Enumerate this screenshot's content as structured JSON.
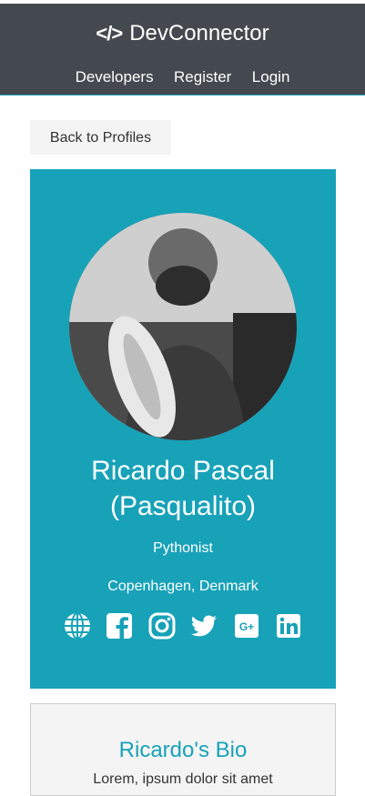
{
  "navbar": {
    "brand_code_icon": "code-icon",
    "brand": "DevConnector",
    "links": [
      "Developers",
      "Register",
      "Login"
    ]
  },
  "back_button": "Back to Profiles",
  "profile": {
    "name_line1": "Ricardo Pascal",
    "name_line2": "(Pasqualito)",
    "title": "Pythonist",
    "location": "Copenhagen, Denmark",
    "socials": [
      "globe-icon",
      "facebook-icon",
      "instagram-icon",
      "twitter-icon",
      "google-plus-icon",
      "linkedin-icon"
    ]
  },
  "bio": {
    "heading": "Ricardo's Bio",
    "text": "Lorem, ipsum dolor sit amet"
  },
  "colors": {
    "accent": "#17a2b8",
    "navbar": "#343a40",
    "light": "#f4f4f4"
  }
}
